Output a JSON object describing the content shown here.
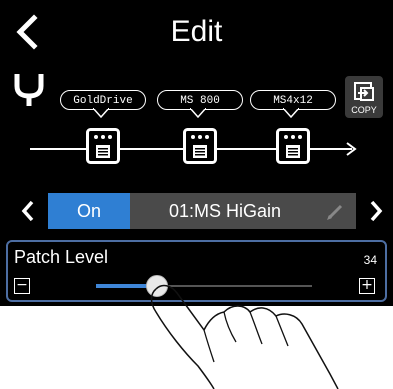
{
  "header": {
    "title": "Edit",
    "back_icon": "chevron-left-icon"
  },
  "toolbar": {
    "tuner_icon": "tuning-fork-icon",
    "copy_label": "COPY",
    "copy_icon": "copy-icon"
  },
  "effects_chain": [
    {
      "label": "GoldDrive",
      "icon": "pedal-icon"
    },
    {
      "label": "MS 800",
      "icon": "pedal-icon"
    },
    {
      "label": "MS4x12",
      "icon": "pedal-icon"
    }
  ],
  "effect_bar": {
    "prev_icon": "chevron-left-icon",
    "next_icon": "chevron-right-icon",
    "status": "On",
    "name": "01:MS HiGain",
    "edit_icon": "pencil-icon"
  },
  "patch_level": {
    "label": "Patch Level",
    "value": "34",
    "max": 120,
    "minus_label": "−",
    "plus_label": "+"
  },
  "colors": {
    "accent": "#2f7fd3",
    "background": "#000000",
    "panel_border": "#4d6ea3"
  }
}
